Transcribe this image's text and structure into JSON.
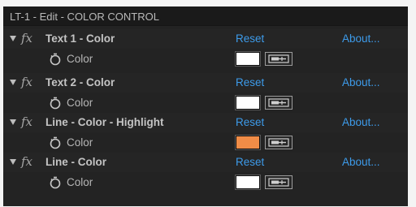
{
  "panel": {
    "title": "LT-1 - Edit - COLOR CONTROL"
  },
  "effects": [
    {
      "name": "Text 1 - Color",
      "reset": "Reset",
      "about": "About...",
      "property": "Color",
      "swatch_color": "#ffffff"
    },
    {
      "name": "Text 2 - Color",
      "reset": "Reset",
      "about": "About...",
      "property": "Color",
      "swatch_color": "#ffffff"
    },
    {
      "name": "Line - Color - Highlight",
      "reset": "Reset",
      "about": "About...",
      "property": "Color",
      "swatch_color": "#f08c47"
    },
    {
      "name": "Line - Color",
      "reset": "Reset",
      "about": "About...",
      "property": "Color",
      "swatch_color": "#ffffff"
    }
  ],
  "icons": {
    "twirl": "triangle-down-icon",
    "fx": "fx-icon",
    "stopwatch": "stopwatch-icon",
    "eyedropper": "eyedropper-icon"
  },
  "colors": {
    "link": "#3d9bea",
    "panel_bg": "#232323",
    "header_bg": "#1a1a1a"
  }
}
